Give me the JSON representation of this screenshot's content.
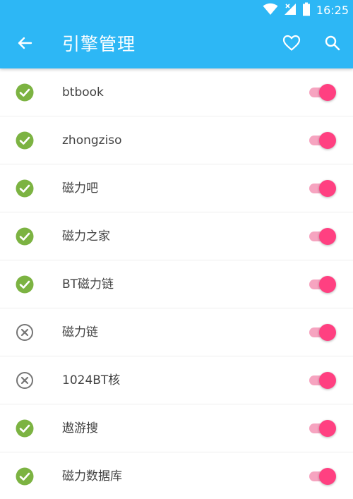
{
  "colors": {
    "appbar": "#2db7f5",
    "ok": "#7cb342",
    "error": "#757575",
    "switch_on": "#ff4081",
    "switch_track": "#f6a4c0"
  },
  "statusbar": {
    "time": "16:25",
    "icons": [
      "wifi-icon",
      "cell-signal-icon",
      "battery-icon"
    ]
  },
  "toolbar": {
    "back_icon": "arrow-left-icon",
    "title": "引擎管理",
    "favorite_icon": "heart-outline-icon",
    "search_icon": "search-icon"
  },
  "engines": [
    {
      "name": "btbook",
      "status": "ok",
      "enabled": true
    },
    {
      "name": "zhongziso",
      "status": "ok",
      "enabled": true
    },
    {
      "name": "磁力吧",
      "status": "ok",
      "enabled": true
    },
    {
      "name": "磁力之家",
      "status": "ok",
      "enabled": true
    },
    {
      "name": "BT磁力链",
      "status": "ok",
      "enabled": true
    },
    {
      "name": "磁力链",
      "status": "error",
      "enabled": true
    },
    {
      "name": "1024BT核",
      "status": "error",
      "enabled": true
    },
    {
      "name": "遨游搜",
      "status": "ok",
      "enabled": true
    },
    {
      "name": "磁力数据库",
      "status": "ok",
      "enabled": true
    }
  ]
}
